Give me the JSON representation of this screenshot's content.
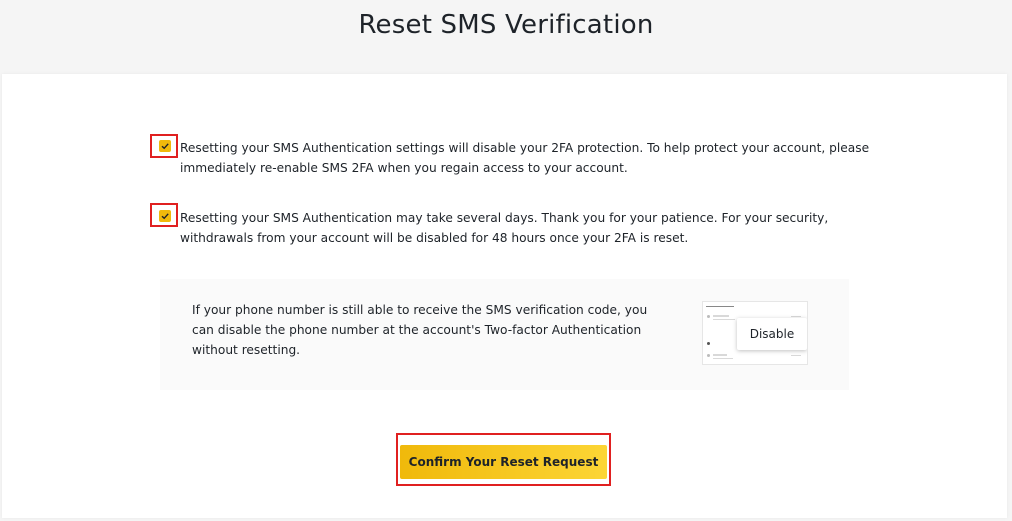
{
  "page": {
    "title": "Reset SMS Verification"
  },
  "checkboxes": [
    {
      "checked": true,
      "text": "Resetting your SMS Authentication settings will disable your 2FA protection. To help protect your account, please immediately re-enable SMS 2FA when you regain access to your account."
    },
    {
      "checked": true,
      "text": "Resetting your SMS Authentication may take several days. Thank you for your patience. For your security, withdrawals from your account will be disabled for 48 hours once your 2FA is reset."
    }
  ],
  "info": {
    "text": "If your phone number is still able to receive the SMS verification code, you can disable the phone number at the account's Two-factor Authentication without resetting.",
    "thumbnail_tooltip": "Disable"
  },
  "confirm": {
    "label": "Confirm Your Reset Request"
  },
  "colors": {
    "accent": "#f0b90b",
    "accent_light": "#fcd535",
    "highlight": "#e02020",
    "text": "#1e2329"
  }
}
